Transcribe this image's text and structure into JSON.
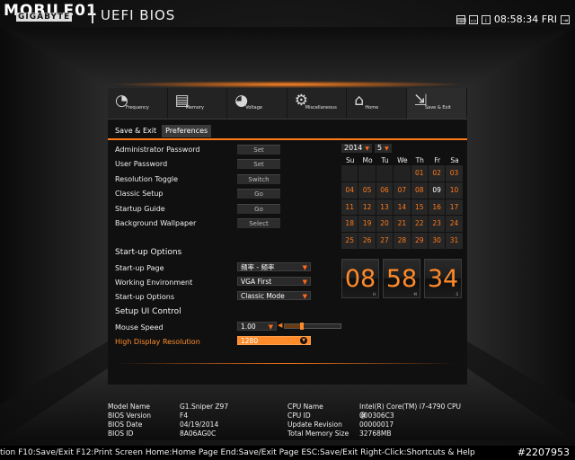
{
  "brand": {
    "logo": "MOBILE01",
    "vendor": "GIGABYTE",
    "title": "UEFI BIOS"
  },
  "tray": {
    "icons": [
      "keyboard-icon",
      "mouse-icon",
      "info-icon"
    ],
    "time": "08:58:34 FRI",
    "close_icon": "exit-icon"
  },
  "nav": [
    {
      "label": "Frequency",
      "icon": "frequency-icon"
    },
    {
      "label": "Memory",
      "icon": "memory-icon"
    },
    {
      "label": "Voltage",
      "icon": "voltage-icon"
    },
    {
      "label": "Miscellaneous",
      "icon": "gear-icon"
    },
    {
      "label": "Home",
      "icon": "home-icon"
    },
    {
      "label": "Save & Exit",
      "icon": "exit-icon"
    }
  ],
  "subtabs": [
    "Save & Exit",
    "Preferences"
  ],
  "settings": [
    {
      "label": "Administrator Password",
      "button": "Set"
    },
    {
      "label": "User Password",
      "button": "Set"
    },
    {
      "label": "Resolution Toggle",
      "button": "Switch"
    },
    {
      "label": "Classic Setup",
      "button": "Go"
    },
    {
      "label": "Startup Guide",
      "button": "Go"
    },
    {
      "label": "Background Wallpaper",
      "button": "Select"
    }
  ],
  "startup": {
    "heading": "Start-up Options",
    "items": [
      {
        "label": "Start-up Page",
        "value": "频率 - 频率"
      },
      {
        "label": "Working Environment",
        "value": "VGA First"
      },
      {
        "label": "Start-up Options",
        "value": "Classic Mode"
      }
    ]
  },
  "ui": {
    "heading": "Setup UI Control",
    "mouse_speed": {
      "label": "Mouse Speed",
      "value": "1.00",
      "level": 0.3
    },
    "resolution": {
      "label": "High Display Resolution",
      "value": "1280"
    }
  },
  "calendar": {
    "year": "2014",
    "month": "5",
    "weekdays": [
      "Su",
      "Mo",
      "Tu",
      "We",
      "Th",
      "Fr",
      "Sa"
    ],
    "days": [
      "",
      "",
      "",
      "",
      "01",
      "02",
      "03",
      "04",
      "05",
      "06",
      "07",
      "08",
      "09",
      "10",
      "11",
      "12",
      "13",
      "14",
      "15",
      "16",
      "17",
      "18",
      "19",
      "20",
      "21",
      "22",
      "23",
      "24",
      "25",
      "26",
      "27",
      "28",
      "29",
      "30",
      "31"
    ],
    "today": "09"
  },
  "clock": {
    "hours": "08",
    "minutes": "58",
    "seconds": "34",
    "h_unit": "H",
    "m_unit": "M",
    "s_unit": "S"
  },
  "sysinfo": {
    "left": [
      {
        "k": "Model Name",
        "v": "G1.Sniper Z97"
      },
      {
        "k": "BIOS Version",
        "v": "F4"
      },
      {
        "k": "BIOS Date",
        "v": "04/19/2014"
      },
      {
        "k": "BIOS ID",
        "v": "8A06AG0C"
      }
    ],
    "right": [
      {
        "k": "CPU Name",
        "v": "Intel(R) Core(TM) i7-4790 CPU @"
      },
      {
        "k": "CPU ID",
        "v": "000306C3"
      },
      {
        "k": "Update Revision",
        "v": "00000017"
      },
      {
        "k": "Total Memory Size",
        "v": "32768MB"
      }
    ]
  },
  "statusbar": "tion F10:Save/Exit F12:Print Screen Home:Home Page End:Save/Exit Page ESC:Save/Exit Right-Click:Shortcuts & Help",
  "watermark": "#2207953",
  "colors": {
    "accent": "#ff7a1a",
    "panel": "#101010",
    "text": "#e8e8e8"
  }
}
